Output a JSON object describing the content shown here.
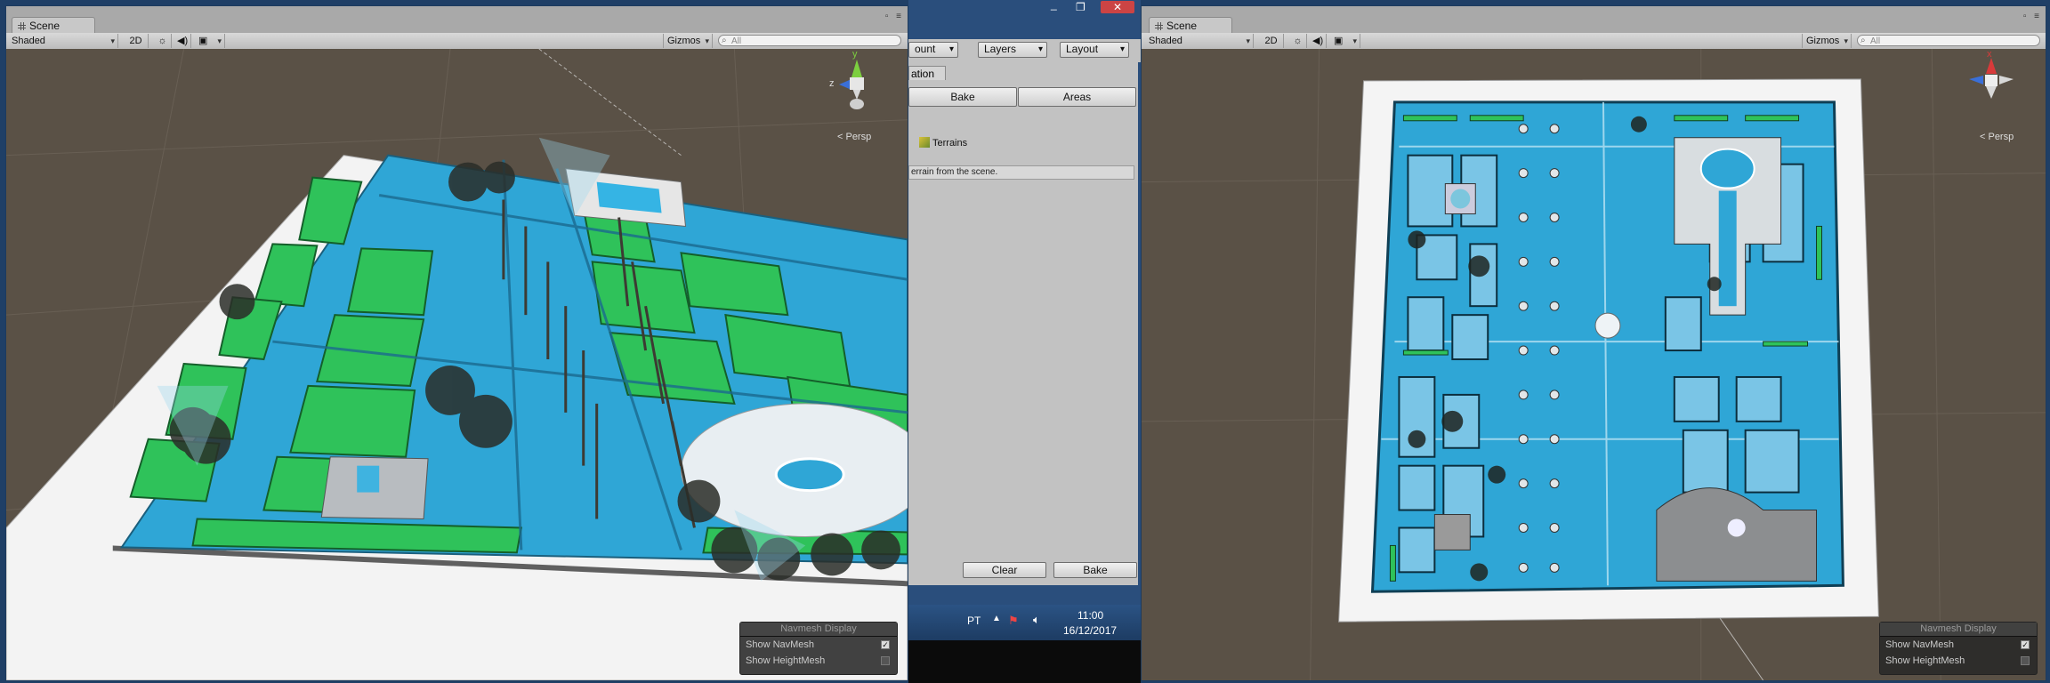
{
  "left_scene": {
    "tab_label": "Scene",
    "toolbar": {
      "shading": "Shaded",
      "mode_2d": "2D",
      "gizmos": "Gizmos",
      "search_placeholder": "All"
    },
    "gizmo_axes": {
      "y": "y",
      "z": "z"
    },
    "persp_label": "< Persp",
    "navmesh_display": {
      "title": "Navmesh Display",
      "show_navmesh": "Show NavMesh",
      "show_navmesh_checked": true,
      "show_heightmesh": "Show HeightMesh",
      "show_heightmesh_checked": false
    }
  },
  "middle": {
    "window_controls": [
      "_",
      "❐",
      "✕"
    ],
    "dropdowns": {
      "account": "ount",
      "layers": "Layers",
      "layout": "Layout"
    },
    "tab_label": "ation",
    "tabs": {
      "bake": "Bake",
      "areas": "Areas"
    },
    "object_label": "Terrains",
    "info_text": "errain from the scene.",
    "buttons": {
      "clear": "Clear",
      "bake": "Bake"
    },
    "taskbar": {
      "language": "PT",
      "time": "11:00",
      "date": "16/12/2017"
    }
  },
  "right_scene": {
    "tab_label": "Scene",
    "toolbar": {
      "shading": "Shaded",
      "mode_2d": "2D",
      "gizmos": "Gizmos",
      "search_placeholder": "All"
    },
    "gizmo_axes": {
      "x": "x"
    },
    "persp_label": "< Persp",
    "navmesh_display": {
      "title": "Navmesh Display",
      "show_navmesh": "Show NavMesh",
      "show_navmesh_checked": true,
      "show_heightmesh": "Show HeightMesh",
      "show_heightmesh_checked": false
    }
  },
  "colors": {
    "viewport_bg": "#5a5146",
    "navmesh_blue": "#2fa6d6",
    "grass_green": "#2fc25a",
    "terrain_white": "#f4f4f4",
    "editor_gray": "#c2c2c2",
    "desktop_blue": "#2a4e7c"
  }
}
